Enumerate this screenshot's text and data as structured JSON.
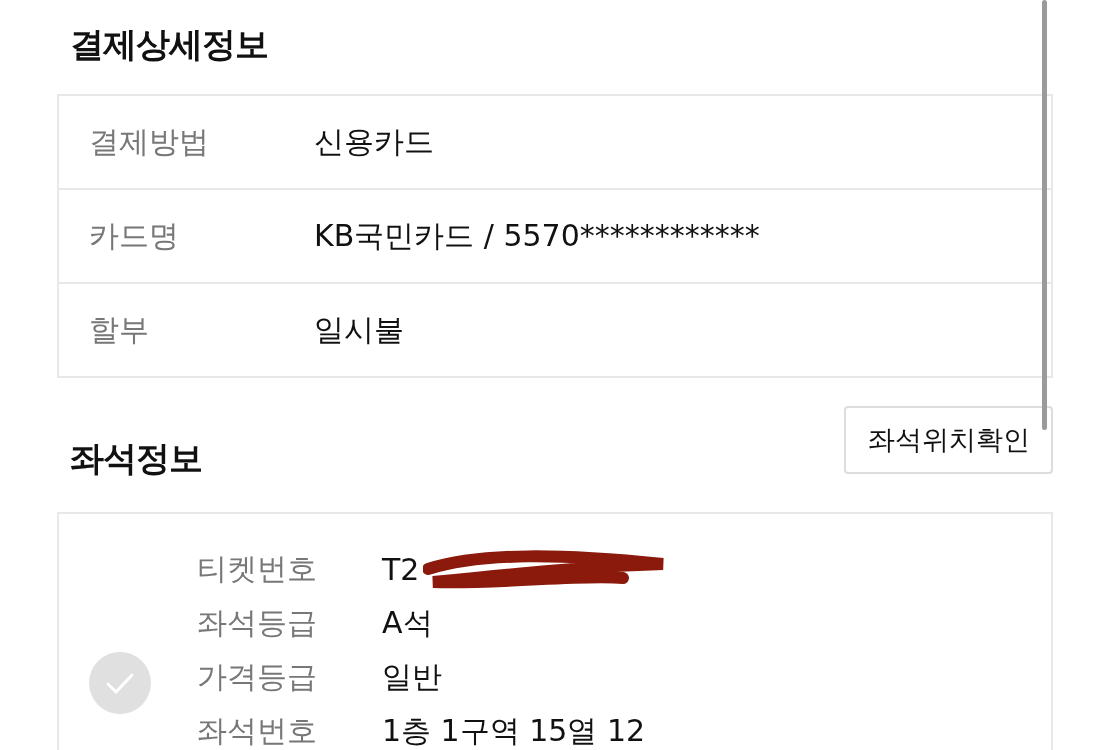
{
  "payment": {
    "title": "결제상세정보",
    "rows": [
      {
        "label": "결제방법",
        "value": "신용카드"
      },
      {
        "label": "카드명",
        "value": "KB국민카드 / 5570************"
      },
      {
        "label": "할부",
        "value": "일시불"
      }
    ]
  },
  "seats": {
    "title": "좌석정보",
    "button": "좌석위치확인",
    "ticket": {
      "checked": false,
      "rows": [
        {
          "label": "티켓번호",
          "value": "T2",
          "redacted": true
        },
        {
          "label": "좌석등급",
          "value": "A석"
        },
        {
          "label": "가격등급",
          "value": "일반"
        },
        {
          "label": "좌석번호",
          "value": "1층 1구역 15열 12"
        }
      ]
    }
  }
}
